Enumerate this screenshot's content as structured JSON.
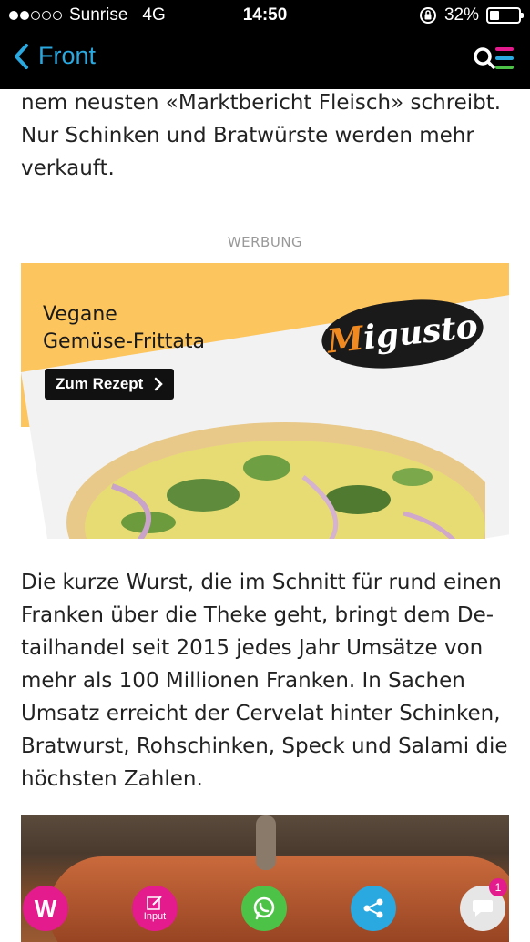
{
  "status_bar": {
    "carrier": "Sunrise",
    "network": "4G",
    "time": "14:50",
    "battery_percent": "32%",
    "battery_level": 0.32,
    "signal_bars_filled": 2,
    "signal_bars_total": 5
  },
  "nav": {
    "back_label": "Front",
    "accent_color": "#2aa8e0"
  },
  "article": {
    "paragraph_1_lines": [
      "nem neusten «Marktbericht Fleisch» schreibt.",
      "Nur Schinken und Bratwürste werden mehr",
      "verkauft."
    ],
    "ad_label": "WERBUNG",
    "ad": {
      "title_line_1": "Vegane",
      "title_line_2": "Gemüse-Frittata",
      "button_label": "Zum Rezept",
      "brand": "Migusto",
      "background_color": "#fdc55e"
    },
    "paragraph_2_lines": [
      "Die kurze Wurst, die im Schnitt für rund einen",
      "Franken über die Theke geht, bringt dem De-",
      "tailhandel seit 2015 jedes Jahr Umsätze von",
      "mehr als 100 Millionen Franken. In Sachen",
      "Umsatz erreicht der Cervelat hinter Schinken,",
      "Bratwurst, Rohschinken, Speck und Salami die",
      "höchsten Zahlen."
    ]
  },
  "bottom_bar": {
    "w_label": "W",
    "input_label": "Input",
    "comment_count": "1",
    "icons": [
      "w-logo-icon",
      "pencil-icon",
      "whatsapp-icon",
      "share-icon",
      "comment-icon"
    ],
    "colors": {
      "pink": "#e31b8c",
      "green": "#4cc247",
      "blue": "#2aa8e0",
      "grey": "#e6e6e6"
    }
  }
}
